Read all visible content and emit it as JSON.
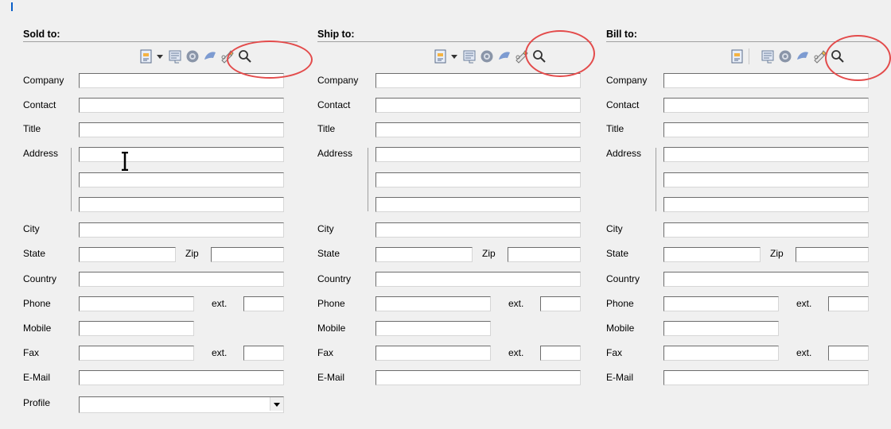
{
  "colors": {
    "highlight": "#e34b4b",
    "accent": "#0a5fc8"
  },
  "labels": {
    "company": "Company",
    "contact": "Contact",
    "title": "Title",
    "address": "Address",
    "city": "City",
    "state": "State",
    "zip": "Zip",
    "country": "Country",
    "phone": "Phone",
    "ext": "ext.",
    "mobile": "Mobile",
    "fax": "Fax",
    "email": "E-Mail",
    "profile": "Profile"
  },
  "panels": [
    {
      "key": "sold",
      "header": "Sold to:"
    },
    {
      "key": "ship",
      "header": "Ship to:"
    },
    {
      "key": "bill",
      "header": "Bill to:"
    }
  ],
  "toolbar_icons": [
    "address-book-icon",
    "dropdown-arrow-icon",
    "copy-address-icon",
    "settings-icon",
    "map-icon",
    "verify-address-icon",
    "search-icon"
  ]
}
